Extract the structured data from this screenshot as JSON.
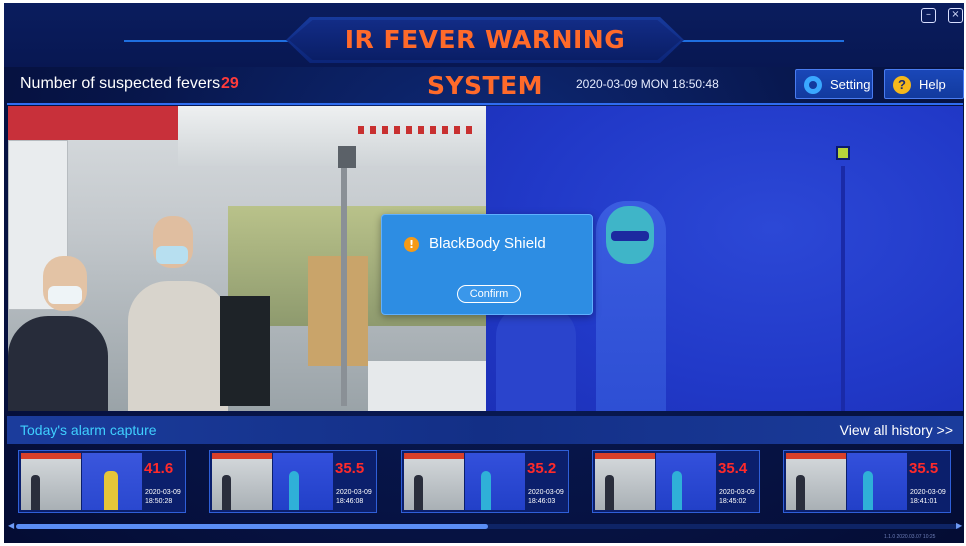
{
  "window": {
    "title": "IR FEVER WARNING SYSTEM",
    "minimize_icon": "minimize-icon",
    "close_icon": "close-icon"
  },
  "status": {
    "fever_label": "Number of suspected fevers",
    "fever_count": "29",
    "datetime": "2020-03-09  MON  18:50:48"
  },
  "toolbar": {
    "setting_label": "Setting",
    "setting_icon": "gear-icon",
    "help_label": "Help",
    "help_icon": "question-icon",
    "help_glyph": "?"
  },
  "dialog": {
    "icon": "warning-icon",
    "icon_glyph": "!",
    "title": "BlackBody Shield",
    "confirm_label": "Confirm"
  },
  "alarm": {
    "title": "Today's alarm capture",
    "view_all_label": "View all history >>",
    "captures": [
      {
        "temp": "41.6",
        "date": "2020-03-09",
        "time": "18:50:28",
        "hot": true
      },
      {
        "temp": "35.5",
        "date": "2020-03-09",
        "time": "18:46:08",
        "hot": false
      },
      {
        "temp": "35.2",
        "date": "2020-03-09",
        "time": "18:46:03",
        "hot": false
      },
      {
        "temp": "35.4",
        "date": "2020-03-09",
        "time": "18:45:02",
        "hot": false
      },
      {
        "temp": "35.5",
        "date": "2020-03-09",
        "time": "18:41:01",
        "hot": false
      }
    ]
  },
  "footer": {
    "version": "1.1.0 2020.03.07 10:25"
  },
  "colors": {
    "title": "#ff6a2a",
    "fever_count": "#ff3b3b",
    "alarm_title": "#3fd0ff",
    "temp": "#ff2a2a",
    "dialog_bg": "#2d8de3"
  }
}
